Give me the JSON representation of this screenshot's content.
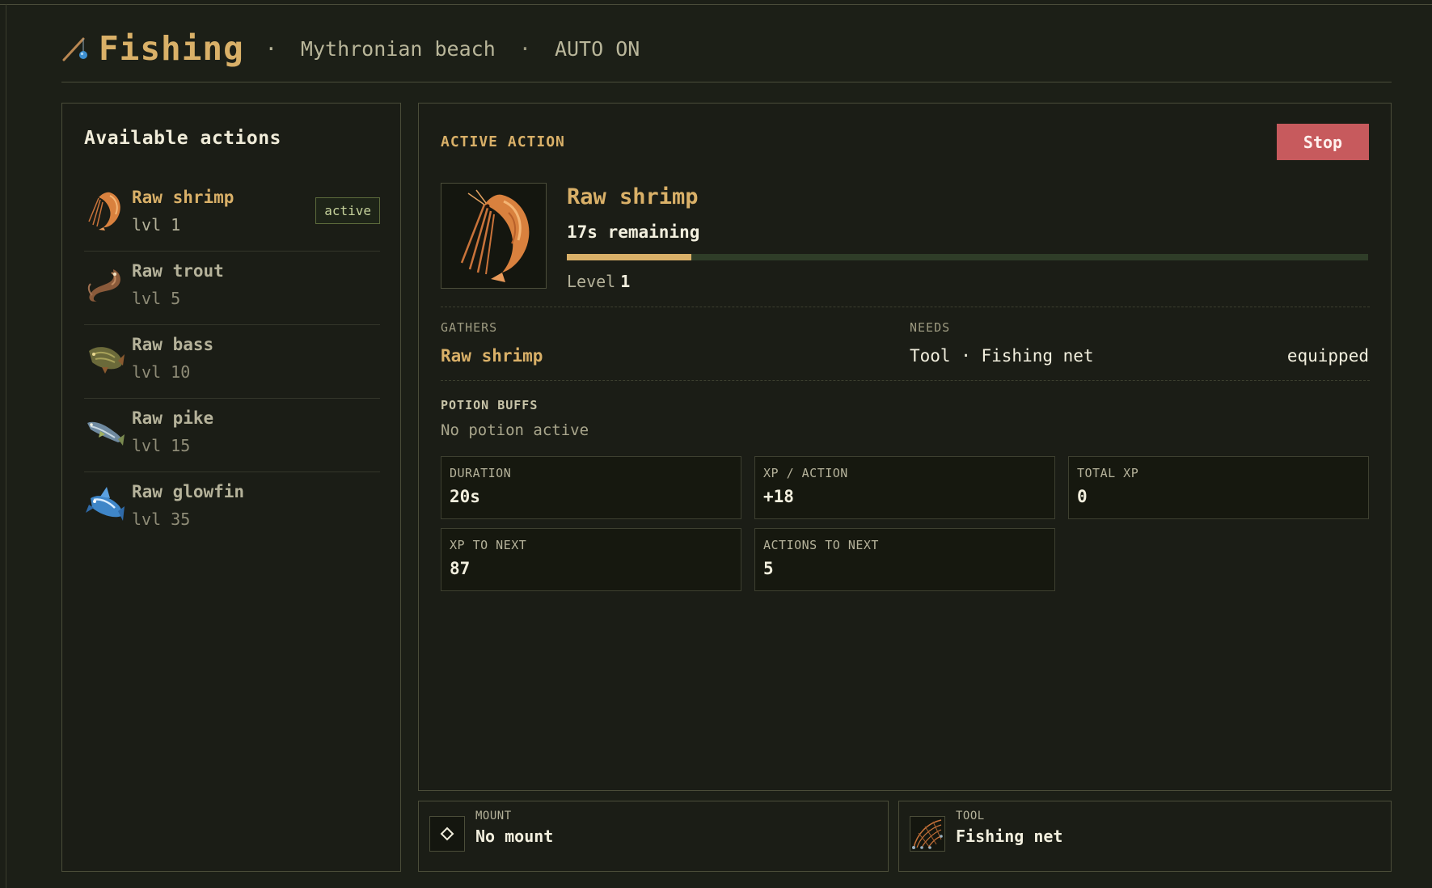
{
  "header": {
    "title": "Fishing",
    "location": "Mythronian beach",
    "auto_status": "AUTO ON",
    "separator": "·"
  },
  "actions_panel": {
    "title": "Available actions",
    "active_badge": "active",
    "items": [
      {
        "name": "Raw shrimp",
        "level": "lvl 1",
        "icon": "shrimp-icon",
        "active": true
      },
      {
        "name": "Raw trout",
        "level": "lvl 5",
        "icon": "trout-icon",
        "active": false
      },
      {
        "name": "Raw bass",
        "level": "lvl 10",
        "icon": "bass-icon",
        "active": false
      },
      {
        "name": "Raw pike",
        "level": "lvl 15",
        "icon": "pike-icon",
        "active": false
      },
      {
        "name": "Raw glowfin",
        "level": "lvl 35",
        "icon": "glowfin-icon",
        "active": false
      }
    ]
  },
  "active_action": {
    "section_label": "ACTIVE ACTION",
    "stop_label": "Stop",
    "name": "Raw shrimp",
    "remaining": "17s remaining",
    "progress_fraction": 0.155,
    "level_label": "Level",
    "level_value": "1",
    "gathers_label": "GATHERS",
    "gathers_value": "Raw shrimp",
    "needs_label": "NEEDS",
    "needs_value": "Tool · Fishing net",
    "needs_status": "equipped",
    "buffs_label": "POTION BUFFS",
    "buffs_value": "No potion active",
    "stats": [
      {
        "label": "DURATION",
        "value": "20s"
      },
      {
        "label": "XP / ACTION",
        "value": "+18"
      },
      {
        "label": "TOTAL XP",
        "value": "0"
      },
      {
        "label": "XP TO NEXT",
        "value": "87"
      },
      {
        "label": "ACTIONS TO NEXT",
        "value": "5"
      }
    ]
  },
  "equipment": {
    "mount_label": "MOUNT",
    "mount_value": "No mount",
    "tool_label": "TOOL",
    "tool_value": "Fishing net"
  },
  "colors": {
    "background": "#1c1f17",
    "accent_gold": "#d9b068",
    "stop_red": "#c75a5d",
    "progress_track": "#2f3d28"
  }
}
